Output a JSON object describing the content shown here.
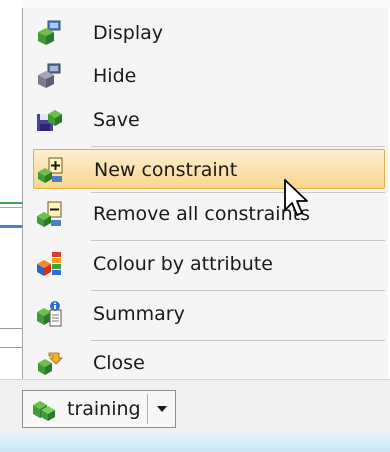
{
  "menu": {
    "items": [
      {
        "label": "Display",
        "icon": "cube-monitor-icon",
        "highlighted": false
      },
      {
        "label": "Hide",
        "icon": "grey-cube-monitor-icon",
        "highlighted": false
      },
      {
        "label": "Save",
        "icon": "floppy-cube-icon",
        "highlighted": false
      },
      {
        "label": "New constraint",
        "icon": "cube-add-constraint-icon",
        "highlighted": true
      },
      {
        "label": "Remove all constraints",
        "icon": "cube-remove-constraints-icon",
        "highlighted": false
      },
      {
        "label": "Colour by attribute",
        "icon": "colour-attribute-icon",
        "highlighted": false
      },
      {
        "label": "Summary",
        "icon": "cube-summary-icon",
        "highlighted": false
      },
      {
        "label": "Close",
        "icon": "cube-close-icon",
        "highlighted": false
      }
    ]
  },
  "taskbar": {
    "button_label": "training",
    "icon": "cube-icon"
  },
  "colors": {
    "highlight": "#f8d68f",
    "highlight_border": "#e4b04a",
    "cube_green": "#3f9a38"
  }
}
